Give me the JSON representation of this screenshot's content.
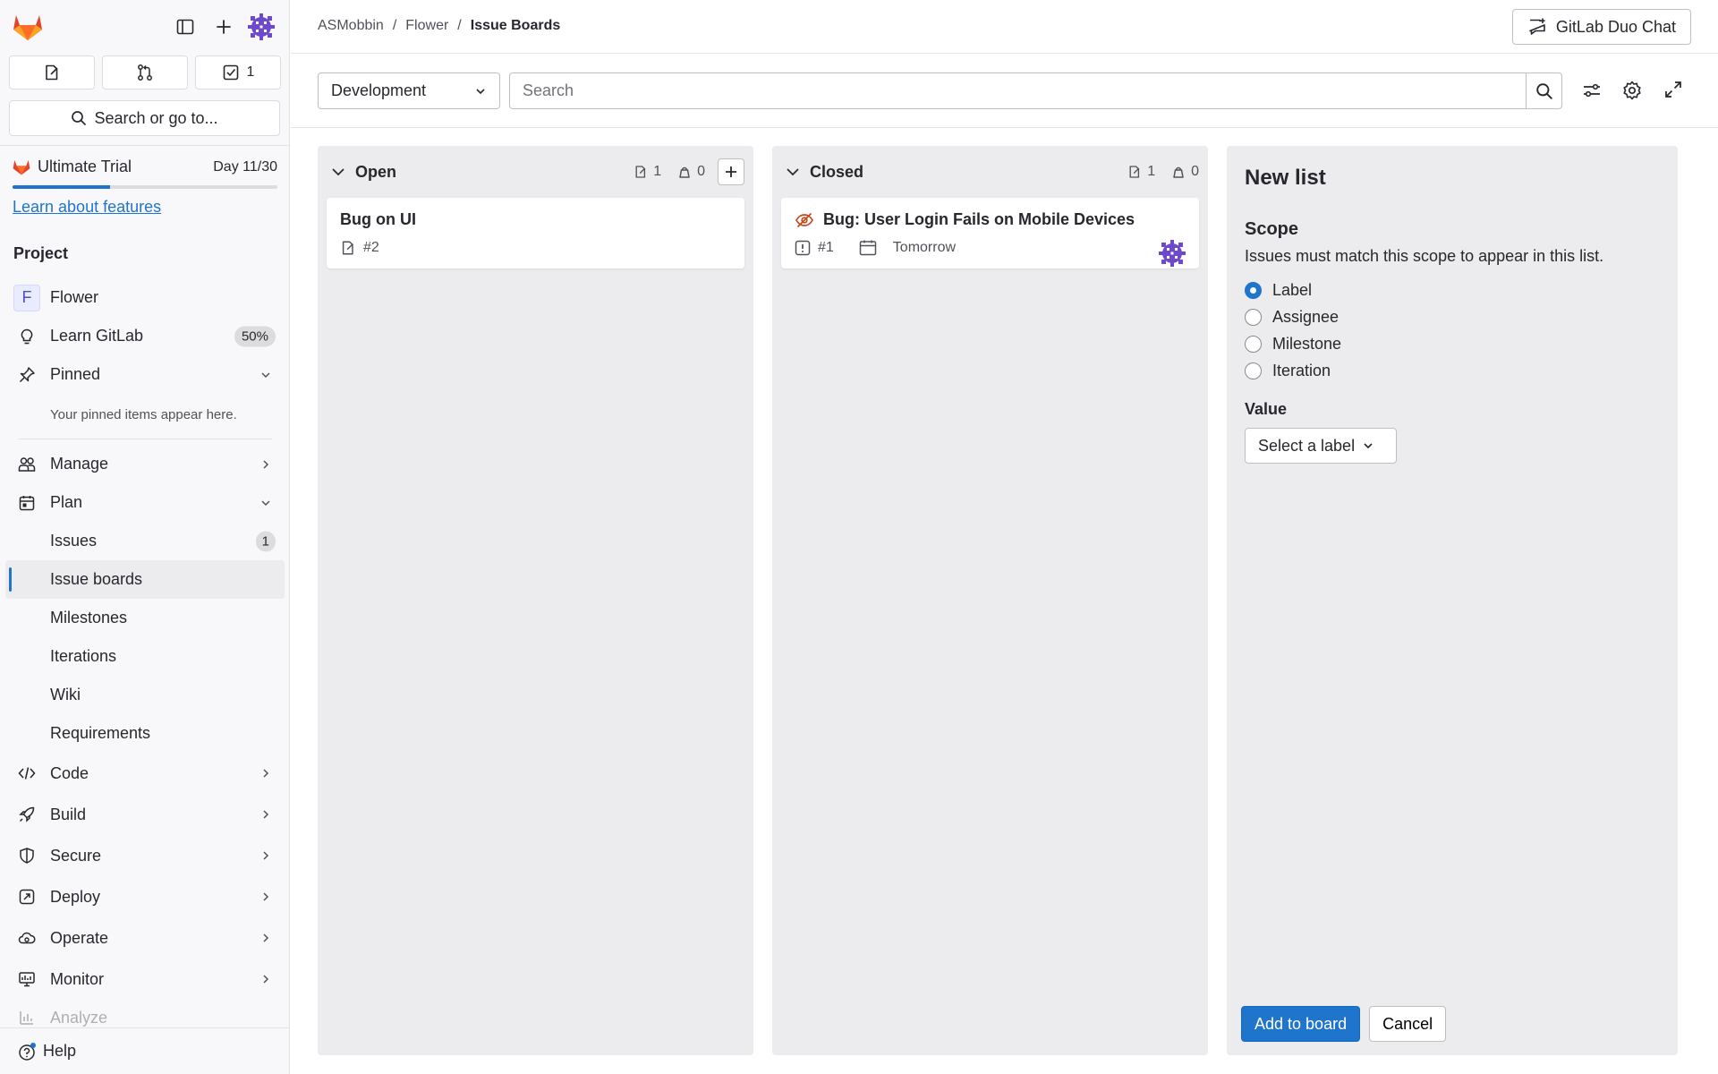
{
  "sidebar": {
    "todo_count": "1",
    "search_label": "Search or go to...",
    "trial": {
      "name": "Ultimate Trial",
      "day": "Day 11/30",
      "progress": 0.3667,
      "link": "Learn about features"
    },
    "section_label": "Project",
    "project": {
      "initial": "F",
      "name": "Flower"
    },
    "learn": {
      "label": "Learn GitLab",
      "percent": "50%"
    },
    "pinned": {
      "label": "Pinned",
      "note": "Your pinned items appear here."
    },
    "manage": "Manage",
    "plan": {
      "label": "Plan",
      "items": [
        {
          "label": "Issues",
          "badge": "1"
        },
        {
          "label": "Issue boards"
        },
        {
          "label": "Milestones"
        },
        {
          "label": "Iterations"
        },
        {
          "label": "Wiki"
        },
        {
          "label": "Requirements"
        }
      ]
    },
    "groups": [
      "Code",
      "Build",
      "Secure",
      "Deploy",
      "Operate",
      "Monitor",
      "Analyze"
    ],
    "help": "Help"
  },
  "header": {
    "breadcrumbs": [
      "ASMobbin",
      "Flower",
      "Issue Boards"
    ],
    "duo_chat": "GitLab Duo Chat"
  },
  "filter": {
    "board": "Development",
    "search_placeholder": "Search"
  },
  "lists": [
    {
      "title": "Open",
      "issue_count": "1",
      "weight": "0",
      "cards": [
        {
          "title": "Bug on UI",
          "ref": "#2"
        }
      ]
    },
    {
      "title": "Closed",
      "issue_count": "1",
      "weight": "0",
      "cards": [
        {
          "title": "Bug: User Login Fails on Mobile Devices",
          "ref": "#1",
          "due": "Tomorrow"
        }
      ]
    }
  ],
  "new_list": {
    "title": "New list",
    "scope_label": "Scope",
    "scope_help": "Issues must match this scope to appear in this list.",
    "options": [
      "Label",
      "Assignee",
      "Milestone",
      "Iteration"
    ],
    "selected": "Label",
    "value_label": "Value",
    "select_placeholder": "Select a label",
    "add_button": "Add to board",
    "cancel_button": "Cancel"
  },
  "colors": {
    "accent": "#1f75cb",
    "brand": "#e24329",
    "avatar": "#6e49cb"
  }
}
